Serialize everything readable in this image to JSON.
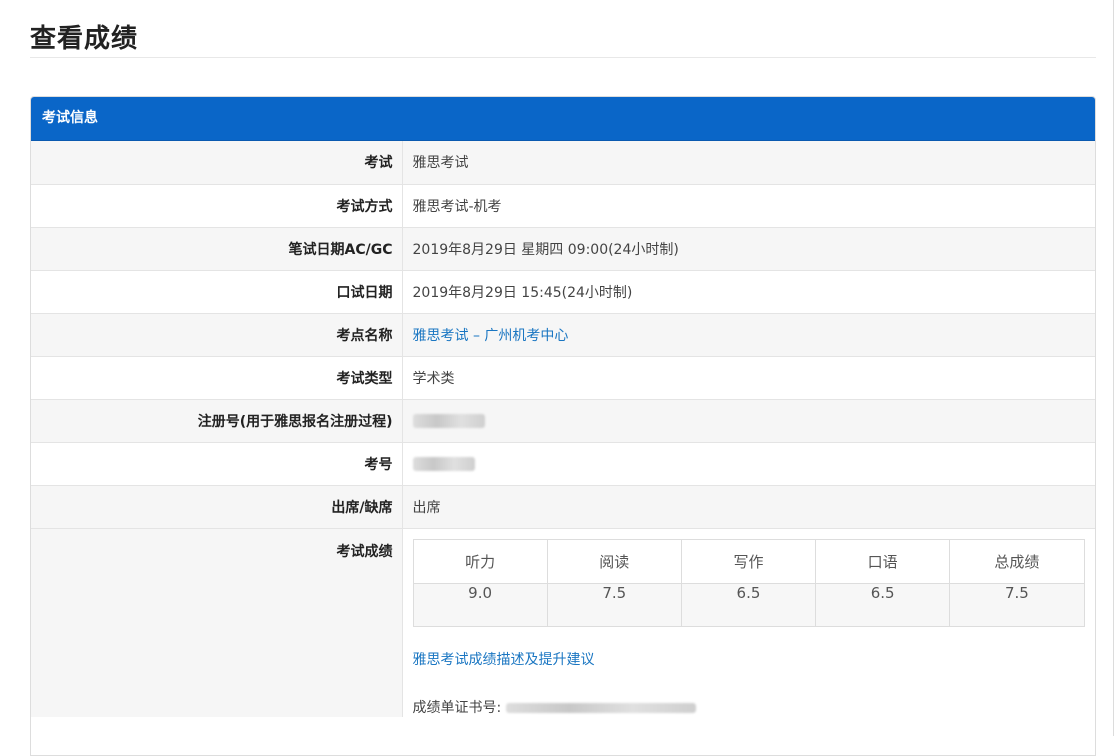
{
  "page": {
    "title": "查看成绩"
  },
  "panel": {
    "header": "考试信息"
  },
  "rows": [
    {
      "label": "考试",
      "value": "雅思考试"
    },
    {
      "label": "考试方式",
      "value": "雅思考试-机考"
    },
    {
      "label": "笔试日期AC/GC",
      "value": "2019年8月29日 星期四 09:00(24小时制)"
    },
    {
      "label": "口试日期",
      "value": "2019年8月29日 15:45(24小时制)"
    },
    {
      "label": "考点名称",
      "value": "雅思考试 – 广州机考中心"
    },
    {
      "label": "考试类型",
      "value": "学术类"
    },
    {
      "label": "注册号(用于雅思报名注册过程)",
      "value": ""
    },
    {
      "label": "考号",
      "value": ""
    },
    {
      "label": "出席/缺席",
      "value": "出席"
    }
  ],
  "scores": {
    "label": "考试成绩",
    "headers": [
      "听力",
      "阅读",
      "写作",
      "口语",
      "总成绩"
    ],
    "values": [
      "9.0",
      "7.5",
      "6.5",
      "6.5",
      "7.5"
    ],
    "link_text": "雅思考试成绩描述及提升建议",
    "cert_label": "成绩单证书号:"
  }
}
